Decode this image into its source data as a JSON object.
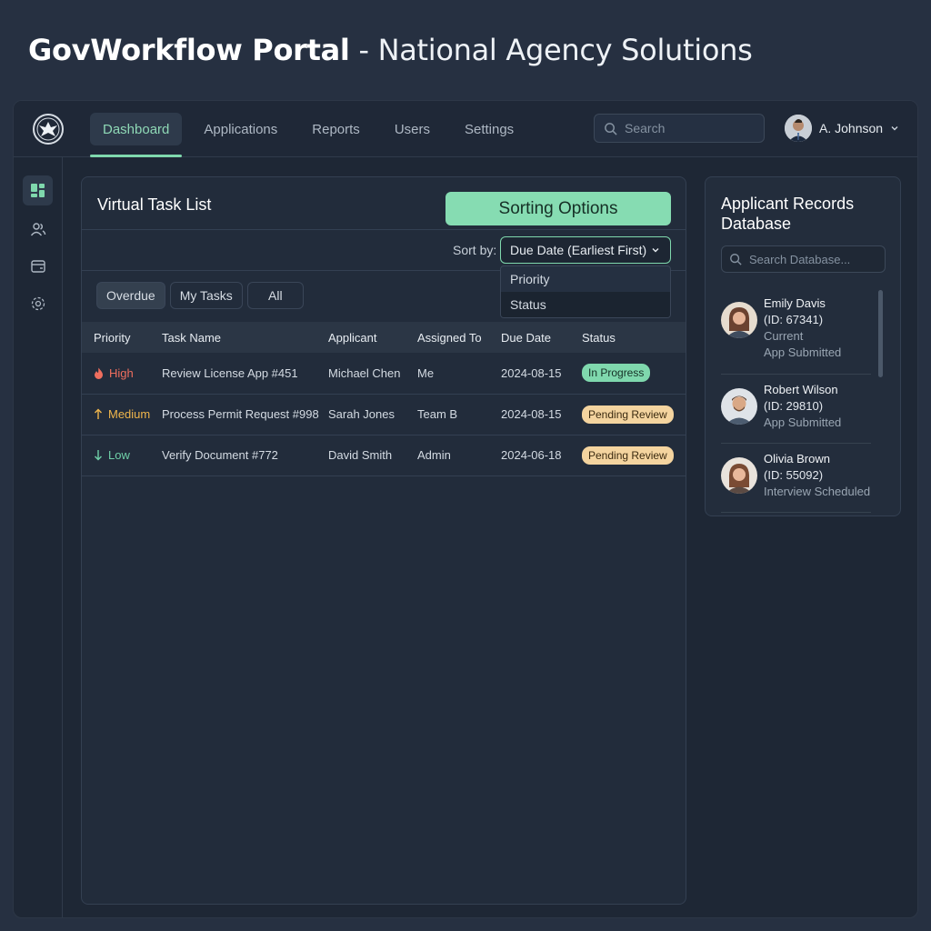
{
  "page": {
    "title_bold": "GovWorkflow Portal",
    "title_rest": "- National Agency Solutions"
  },
  "topbar": {
    "nav": [
      "Dashboard",
      "Applications",
      "Reports",
      "Users",
      "Settings"
    ],
    "search_placeholder": "Search",
    "user_name": "A. Johnson"
  },
  "tasks": {
    "title": "Virtual Task List",
    "sorting_button": "Sorting Options",
    "sort_label": "Sort by:",
    "sort_selected": "Due Date (Earliest First)",
    "sort_options": [
      "Priority",
      "Status"
    ],
    "filters": [
      "Overdue",
      "My Tasks",
      "All"
    ],
    "columns": [
      "Priority",
      "Task Name",
      "Applicant",
      "Assigned To",
      "Due Date",
      "Status"
    ],
    "rows": [
      {
        "priority": "High",
        "task": "Review License App #451",
        "applicant": "Michael Chen",
        "assigned": "Me",
        "due": "2024-08-15",
        "status": "In Progress"
      },
      {
        "priority": "Medium",
        "task": "Process Permit Request #998",
        "applicant": "Sarah Jones",
        "assigned": "Team B",
        "due": "2024-08-15",
        "status": "Pending Review"
      },
      {
        "priority": "Low",
        "task": "Verify Document #772",
        "applicant": "David Smith",
        "assigned": "Admin",
        "due": "2024-06-18",
        "status": "Pending Review"
      }
    ]
  },
  "database": {
    "title": "Applicant Records Database",
    "search_placeholder": "Search Database...",
    "applicants": [
      {
        "name": "Emily Davis",
        "id": "(ID: 67341)",
        "status_line1": "Current",
        "status_line2": "App Submitted"
      },
      {
        "name": "Robert Wilson",
        "id": "(ID: 29810)",
        "status_line1": "App Submitted"
      },
      {
        "name": "Olivia Brown",
        "id": "(ID: 55092)",
        "status_line1": "Interview Scheduled"
      }
    ]
  },
  "colors": {
    "accent": "#7fd8ad",
    "high": "#ef6e5e",
    "medium": "#f0b64c",
    "low": "#6fd0a8",
    "pending": "#f4d49f"
  },
  "icons": {
    "logo": "agency-seal-icon",
    "search": "search-icon",
    "dropdown": "chevron-down-icon",
    "sidebar": [
      "dashboard-grid-icon",
      "users-icon",
      "wallet-icon",
      "settings-gear-icon"
    ],
    "priority": [
      "flame-icon",
      "arrow-up-icon",
      "arrow-down-icon"
    ]
  }
}
